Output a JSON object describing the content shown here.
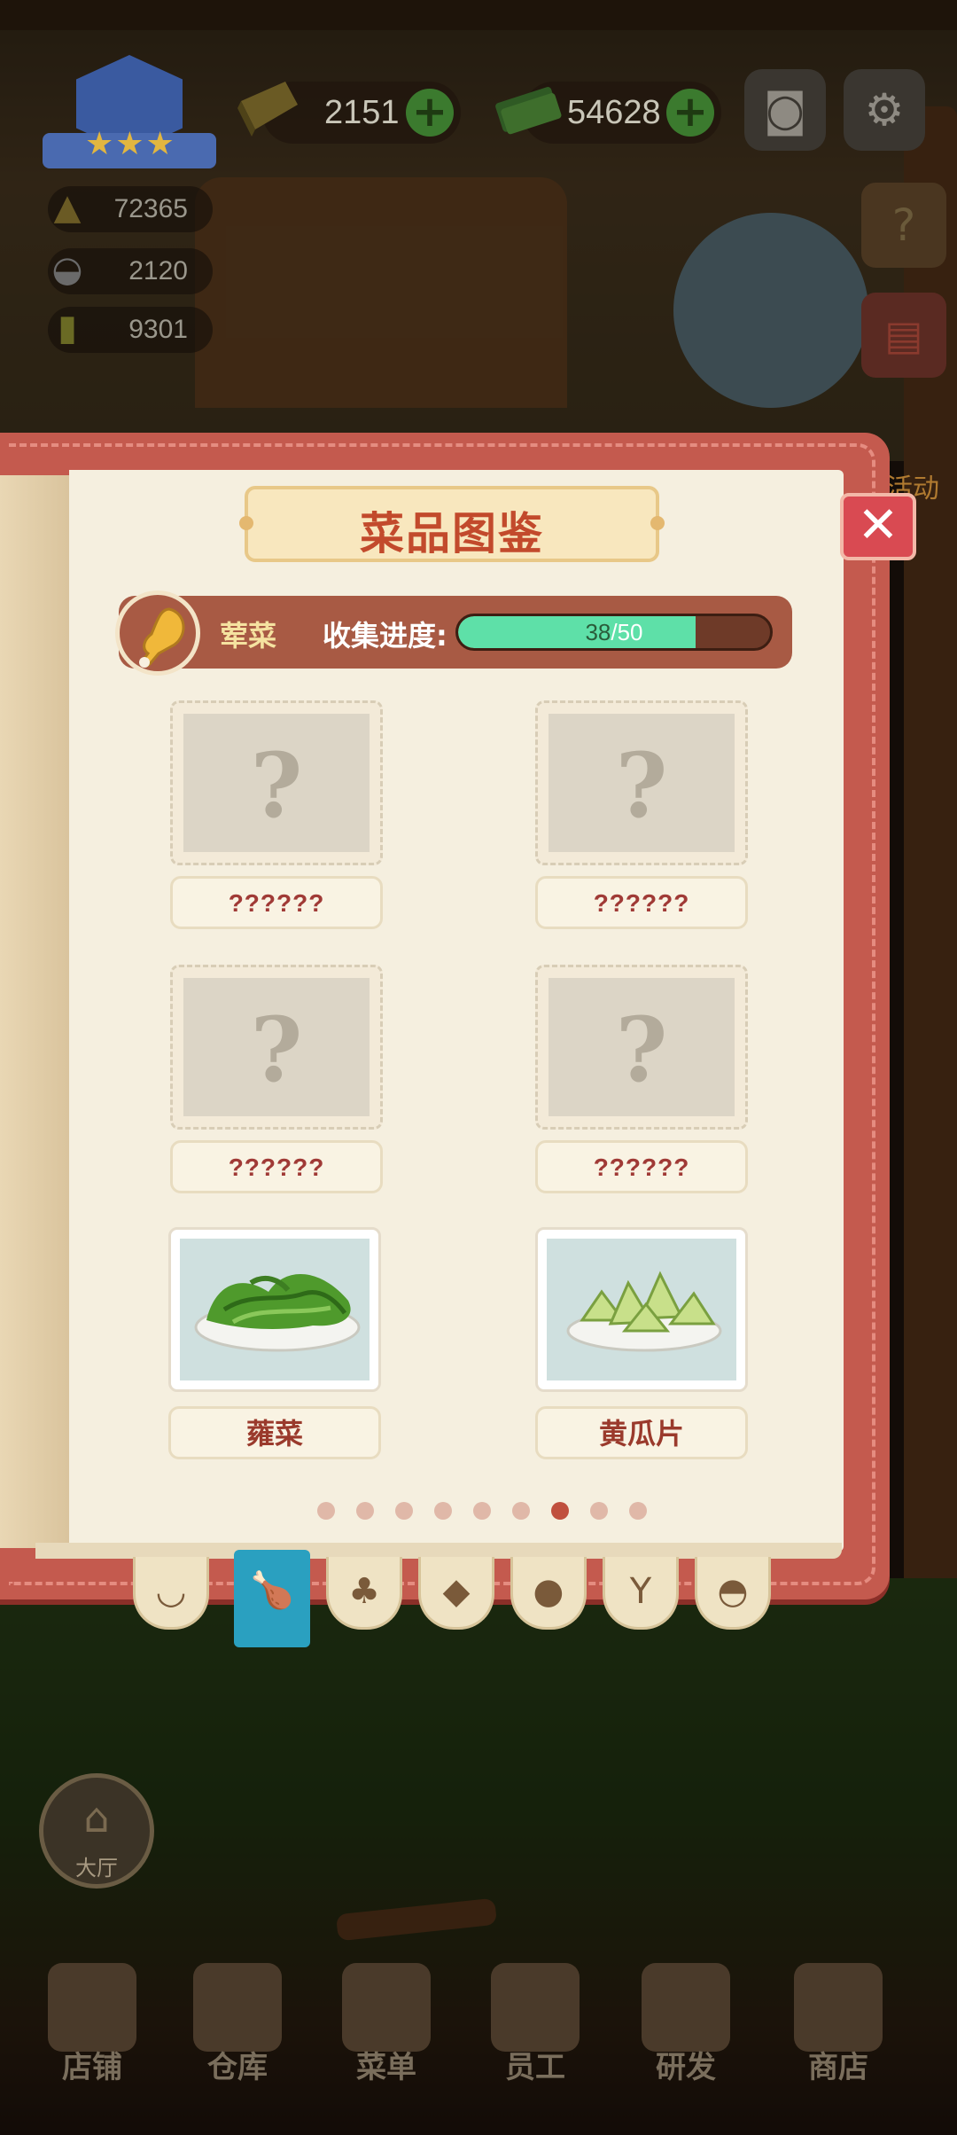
{
  "hud": {
    "currency_gold": "2151",
    "currency_cash": "54628",
    "stats": [
      "72365",
      "2120",
      "9301"
    ],
    "event_label": "活动",
    "icons": [
      "gold-ingot-icon",
      "cash-stack-icon",
      "camera-icon",
      "gear-icon",
      "guide-book-icon",
      "recipe-book-icon"
    ]
  },
  "book": {
    "title": "菜品图鉴",
    "category_name": "荤菜",
    "progress_label": "收集进度:",
    "progress_current": "38",
    "progress_total": "/50",
    "progress_fraction": 0.76,
    "dishes": [
      {
        "name": "??????",
        "locked": true
      },
      {
        "name": "??????",
        "locked": true
      },
      {
        "name": "??????",
        "locked": true
      },
      {
        "name": "??????",
        "locked": true
      },
      {
        "name": "蕹菜",
        "locked": false,
        "image": "water-spinach-dish"
      },
      {
        "name": "黄瓜片",
        "locked": false,
        "image": "cucumber-slices-dish"
      }
    ],
    "page_count": 9,
    "active_page": 7,
    "tabs": [
      {
        "icon": "wok-icon",
        "active": false
      },
      {
        "icon": "drumstick-icon",
        "active": true
      },
      {
        "icon": "broccoli-icon",
        "active": false
      },
      {
        "icon": "fish-icon",
        "active": false
      },
      {
        "icon": "bread-icon",
        "active": false
      },
      {
        "icon": "wine-glass-icon",
        "active": false
      },
      {
        "icon": "soup-bowl-icon",
        "active": false
      }
    ]
  },
  "nav": {
    "hall_label": "大厅",
    "items": [
      "店铺",
      "仓库",
      "菜单",
      "员工",
      "研发",
      "商店"
    ]
  }
}
